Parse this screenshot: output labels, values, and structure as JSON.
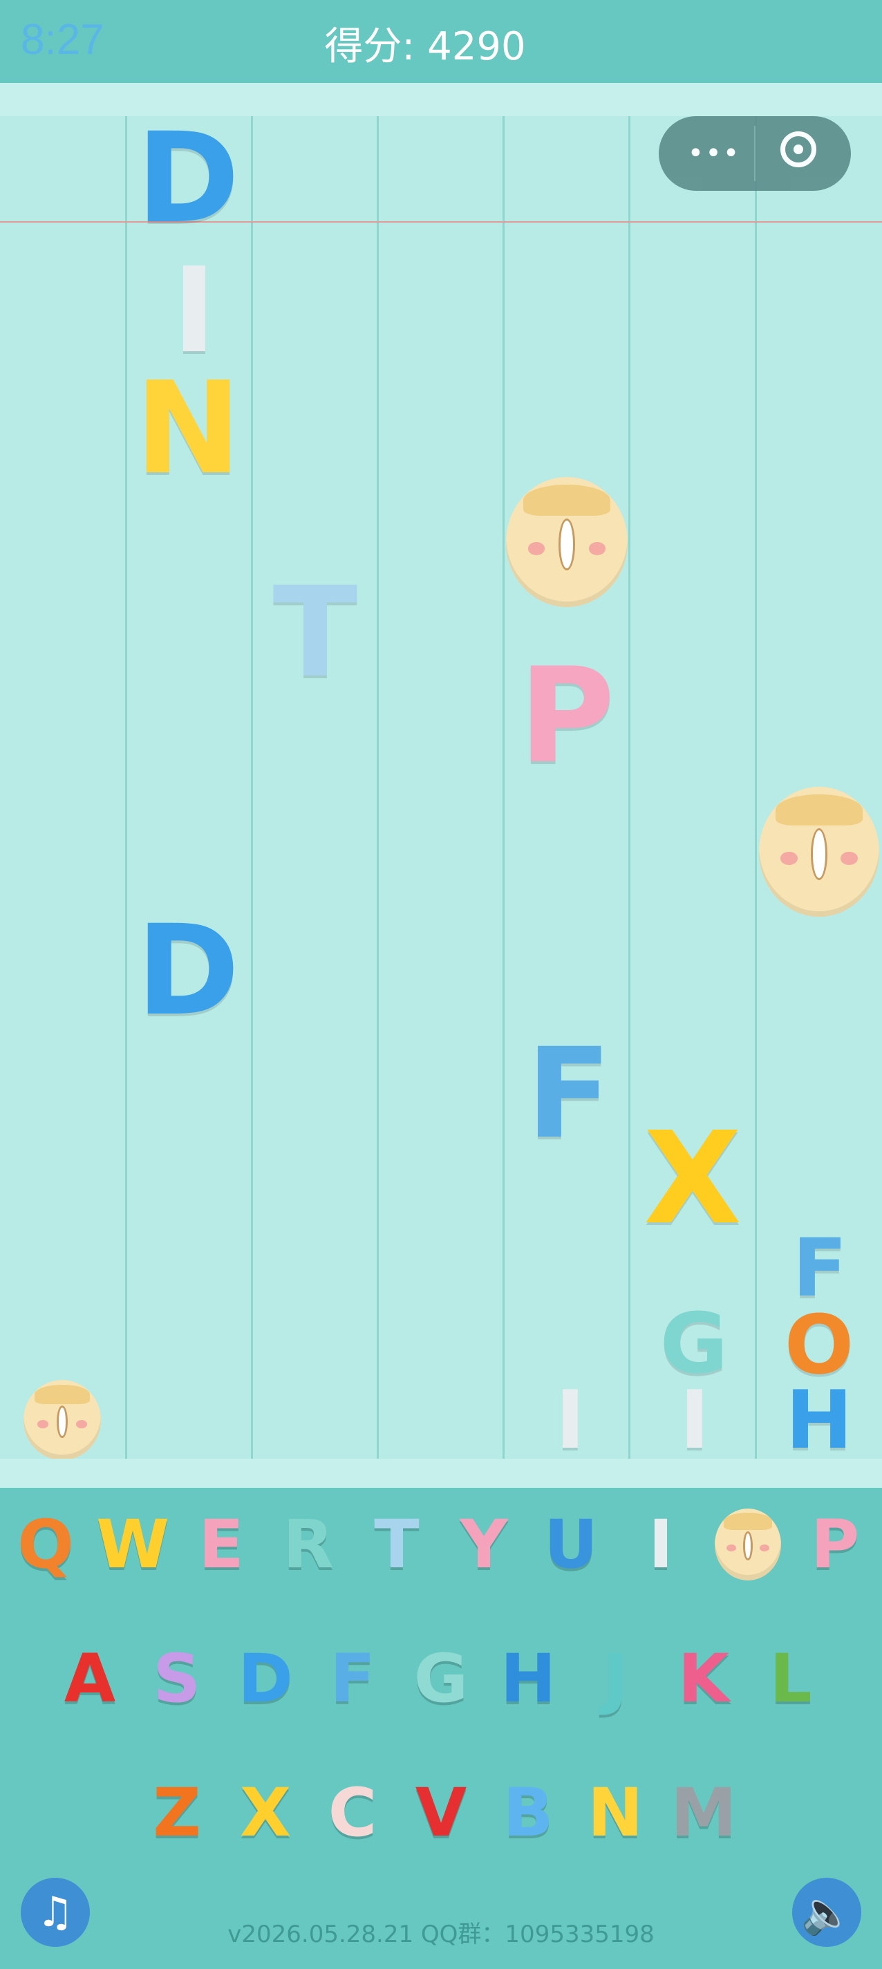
{
  "header": {
    "time": "8:27",
    "score_label": "得分: 4290"
  },
  "capsule": {
    "more_icon": "more-dots-icon",
    "record_icon": "record-circle-icon"
  },
  "playfield": {
    "lanes": 7,
    "tiles": [
      {
        "letter": "D",
        "color": "#3aa0ea"
      },
      {
        "letter": "I",
        "color": "#e8eef0"
      },
      {
        "letter": "N",
        "color": "#ffd43a"
      },
      {
        "letter": "O",
        "color": "#f7e3b3"
      },
      {
        "letter": "T",
        "color": "#a9d4ee"
      },
      {
        "letter": "P",
        "color": "#f6a6c0"
      },
      {
        "letter": "O",
        "color": "#f7e3b3"
      },
      {
        "letter": "D",
        "color": "#3aa0ea"
      },
      {
        "letter": "F",
        "color": "#5aaee6"
      },
      {
        "letter": "X",
        "color": "#ffcc1f"
      },
      {
        "letter": "F",
        "color": "#5aaee6"
      },
      {
        "letter": "G",
        "color": "#7fd6d0"
      },
      {
        "letter": "O",
        "color": "#f28a2b"
      },
      {
        "letter": "O",
        "color": "#f7e3b3"
      },
      {
        "letter": "I",
        "color": "#e8eef0"
      },
      {
        "letter": "I",
        "color": "#e8eef0"
      },
      {
        "letter": "H",
        "color": "#3aa0ea"
      }
    ]
  },
  "keyboard": {
    "row1": [
      "Q",
      "W",
      "E",
      "R",
      "T",
      "Y",
      "U",
      "I",
      "O",
      "P"
    ],
    "row2": [
      "A",
      "S",
      "D",
      "F",
      "G",
      "H",
      "J",
      "K",
      "L"
    ],
    "row3": [
      "Z",
      "X",
      "C",
      "V",
      "B",
      "N",
      "M"
    ]
  },
  "footer": {
    "version": "v2026.05.28.21 QQ群：1095335198",
    "music_icon": "music-note-icon",
    "sound_icon": "speaker-icon"
  },
  "colors": {
    "header": "#66c8c1",
    "field": "#b8ebe6",
    "keyboard": "#66c8c1"
  }
}
